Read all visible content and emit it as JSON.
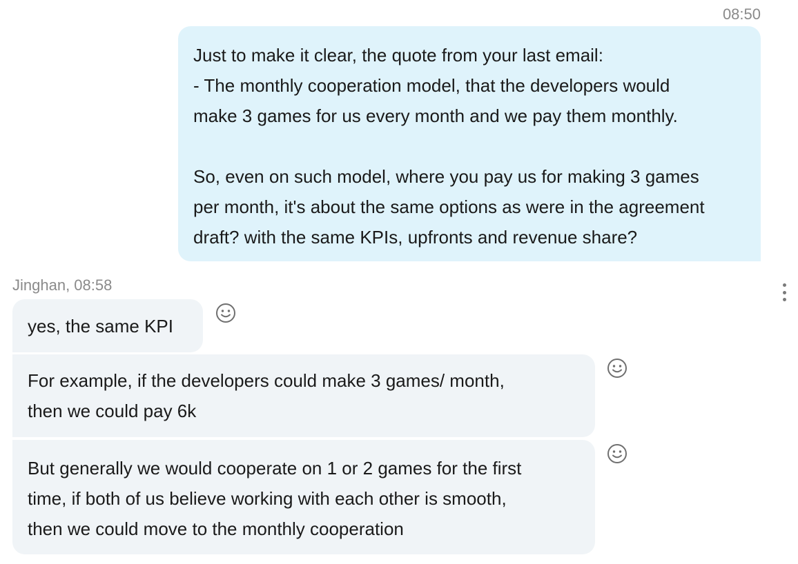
{
  "outgoing_message": {
    "time": "08:50",
    "lines": [
      "Just to make it clear, the quote from your last email:",
      "- The monthly cooperation model, that the developers would",
      "make 3 games for us every month and we pay them monthly.",
      "",
      "So, even on such model, where you pay us for making 3 games",
      "per month, it's about the same options as were in the agreement",
      "draft? with the same KPIs, upfronts and revenue share?"
    ]
  },
  "incoming_group": {
    "sender_meta": "Jinghan, 08:58",
    "messages": [
      {
        "lines": [
          "yes, the same KPI"
        ]
      },
      {
        "lines": [
          "For example, if the developers could make 3 games/ month,",
          "then we could pay 6k"
        ]
      },
      {
        "lines": [
          "But generally we would cooperate on 1 or 2 games for the first",
          "time, if both of us believe working with each other is smooth,",
          "then we could move to the monthly cooperation"
        ]
      }
    ]
  },
  "icons": {
    "reaction": "smiley-face-icon",
    "more": "more-vertical-icon"
  },
  "colors": {
    "outgoing_bubble": "#dff3fb",
    "incoming_bubble": "#f0f4f7",
    "meta_text": "#8a8a8a"
  }
}
